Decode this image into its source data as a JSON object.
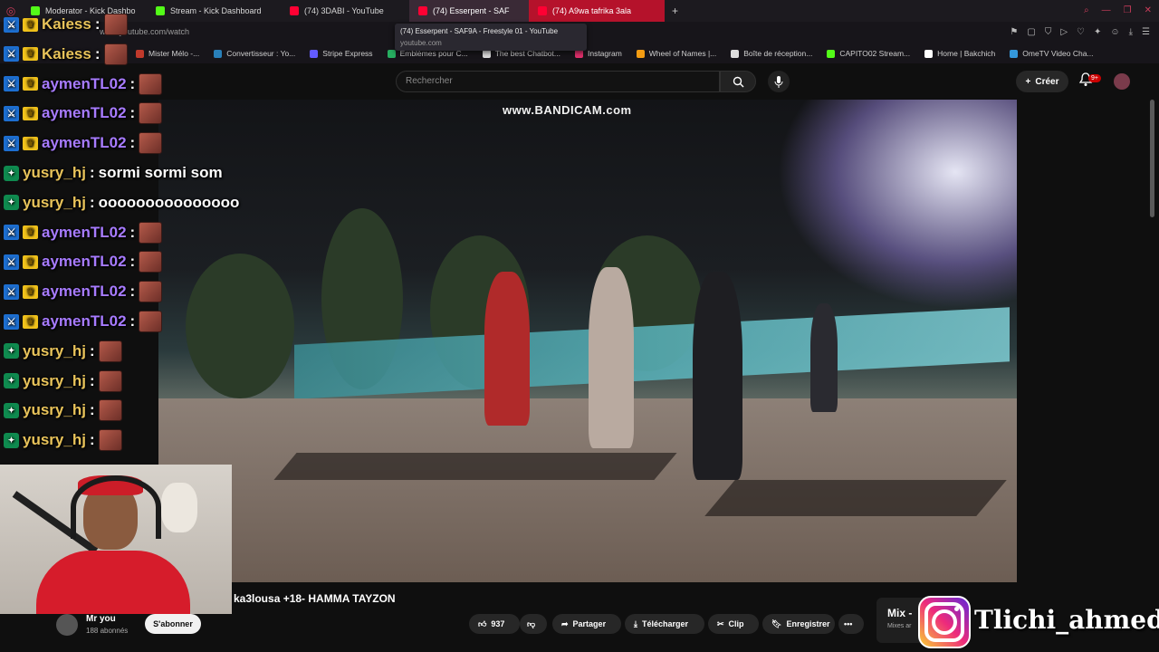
{
  "browser": {
    "tabs": [
      {
        "label": "Moderator - Kick Dashbo",
        "color": "#53fc18"
      },
      {
        "label": "Stream - Kick Dashboard",
        "color": "#53fc18"
      },
      {
        "label": "(74) 3DABI - YouTube",
        "color": "#ff0033"
      },
      {
        "label": "(74) Esserpent - SAF",
        "color": "#ff0033"
      },
      {
        "label": "(74) A9wa tafrika 3ala",
        "color": "#ff0033"
      }
    ],
    "new_tab": "+",
    "url": "www.youtube.com/watch",
    "tooltip_title": "(74) Esserpent - SAF9A - Freestyle 01 - YouTube",
    "tooltip_url": "youtube.com",
    "bookmarks": [
      {
        "label": "Mister Mélo -...",
        "color": "#c0392b"
      },
      {
        "label": "Convertisseur : Yo...",
        "color": "#2980b9"
      },
      {
        "label": "Stripe Express",
        "color": "#635bff"
      },
      {
        "label": "Emblèmes pour C...",
        "color": "#27ae60"
      },
      {
        "label": "The best Chatbot...",
        "color": "#ddd"
      },
      {
        "label": "Instagram",
        "color": "#e1306c"
      },
      {
        "label": "Wheel of Names |...",
        "color": "#f39c12"
      },
      {
        "label": "Boîte de réception...",
        "color": "#ddd"
      },
      {
        "label": "CAPITO02 Stream...",
        "color": "#53fc18"
      },
      {
        "label": "Home | Bakchich",
        "color": "#fff"
      },
      {
        "label": "OmeTV Video Cha...",
        "color": "#3498db"
      }
    ]
  },
  "youtube": {
    "search_placeholder": "Rechercher",
    "create_label": "Créer",
    "notif_badge": "9+",
    "video_watermark": "www.BANDICAM.com",
    "video_title": "ka3lousa +18- HAMMA TAYZON",
    "channel_name": "Mr you",
    "channel_subs": "188 abonnés",
    "subscribe_label": "S'abonner",
    "like_count": "937",
    "share_label": "Partager",
    "download_label": "Télécharger",
    "clip_label": "Clip",
    "save_label": "Enregistrer",
    "more_label": "•••",
    "mix_title": "Mix -",
    "mix_sub": "Mixes ar"
  },
  "chat": [
    {
      "user": "Kaiess",
      "color": "#e8c35a",
      "badges": [
        "blue",
        "crown"
      ],
      "text": "",
      "emote": true
    },
    {
      "user": "Kaiess",
      "color": "#e8c35a",
      "badges": [
        "blue",
        "crown"
      ],
      "text": "",
      "emote": true
    },
    {
      "user": "aymenTL02",
      "color": "#a77bff",
      "badges": [
        "blue",
        "crown"
      ],
      "text": "",
      "emote": true
    },
    {
      "user": "aymenTL02",
      "color": "#a77bff",
      "badges": [
        "blue",
        "crown"
      ],
      "text": "",
      "emote": true
    },
    {
      "user": "aymenTL02",
      "color": "#a77bff",
      "badges": [
        "blue",
        "crown"
      ],
      "text": "",
      "emote": true
    },
    {
      "user": "yusry_hj",
      "color": "#e8c35a",
      "badges": [
        "green"
      ],
      "text": "sormi sormi som",
      "emote": false
    },
    {
      "user": "yusry_hj",
      "color": "#e8c35a",
      "badges": [
        "green"
      ],
      "text": "ooooooooooooooo",
      "emote": false
    },
    {
      "user": "aymenTL02",
      "color": "#a77bff",
      "badges": [
        "blue",
        "crown"
      ],
      "text": "",
      "emote": true
    },
    {
      "user": "aymenTL02",
      "color": "#a77bff",
      "badges": [
        "blue",
        "crown"
      ],
      "text": "",
      "emote": true
    },
    {
      "user": "aymenTL02",
      "color": "#a77bff",
      "badges": [
        "blue",
        "crown"
      ],
      "text": "",
      "emote": true
    },
    {
      "user": "aymenTL02",
      "color": "#a77bff",
      "badges": [
        "blue",
        "crown"
      ],
      "text": "",
      "emote": true
    },
    {
      "user": "yusry_hj",
      "color": "#e8c35a",
      "badges": [
        "green"
      ],
      "text": "",
      "emote": true
    },
    {
      "user": "yusry_hj",
      "color": "#e8c35a",
      "badges": [
        "green"
      ],
      "text": "",
      "emote": true
    },
    {
      "user": "yusry_hj",
      "color": "#e8c35a",
      "badges": [
        "green"
      ],
      "text": "",
      "emote": true
    },
    {
      "user": "yusry_hj",
      "color": "#e8c35a",
      "badges": [
        "green"
      ],
      "text": "",
      "emote": true
    }
  ],
  "overlay": {
    "instagram_handle": "Tlichi_ahmed"
  }
}
